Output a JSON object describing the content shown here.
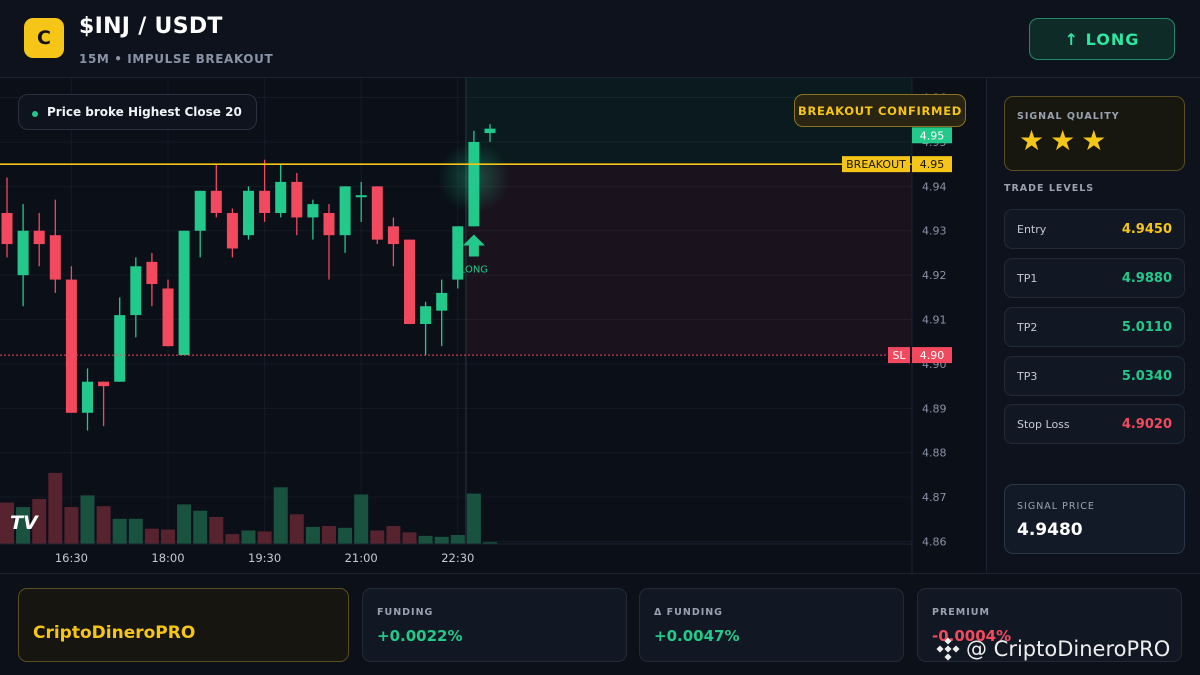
{
  "header": {
    "logo_letter": "C",
    "pair": "$INJ / USDT",
    "subtitle": "15M • IMPULSE BREAKOUT",
    "direction_label": "↑ LONG"
  },
  "chart": {
    "pill_text": "Price broke Highest Close 20",
    "confirm_label": "BREAKOUT CONFIRMED",
    "signal_marker_label": "LONG",
    "tv_logo": "TV",
    "colors": {
      "up": "#22c98a",
      "down": "#f2495e",
      "breakout": "#f5c518",
      "stop": "#f2495e"
    }
  },
  "chart_data": {
    "type": "candlestick",
    "y_ticks": [
      "4.96",
      "4.95",
      "4.94",
      "4.93",
      "4.92",
      "4.91",
      "4.90",
      "4.89",
      "4.88",
      "4.87",
      "4.86"
    ],
    "ylim": [
      4.857,
      4.9617
    ],
    "x_ticks": [
      {
        "label": "16:30",
        "index": 4
      },
      {
        "label": "18:00",
        "index": 10
      },
      {
        "label": "19:30",
        "index": 16
      },
      {
        "label": "21:00",
        "index": 22
      },
      {
        "label": "22:30",
        "index": 28
      }
    ],
    "candles": [
      {
        "o": 4.934,
        "h": 4.942,
        "l": 4.924,
        "c": 4.927
      },
      {
        "o": 4.92,
        "h": 4.936,
        "l": 4.913,
        "c": 4.93
      },
      {
        "o": 4.93,
        "h": 4.934,
        "l": 4.922,
        "c": 4.927
      },
      {
        "o": 4.929,
        "h": 4.937,
        "l": 4.916,
        "c": 4.919
      },
      {
        "o": 4.919,
        "h": 4.922,
        "l": 4.889,
        "c": 4.889
      },
      {
        "o": 4.889,
        "h": 4.899,
        "l": 4.885,
        "c": 4.896
      },
      {
        "o": 4.896,
        "h": 4.896,
        "l": 4.886,
        "c": 4.895
      },
      {
        "o": 4.896,
        "h": 4.915,
        "l": 4.896,
        "c": 4.911
      },
      {
        "o": 4.911,
        "h": 4.924,
        "l": 4.906,
        "c": 4.922
      },
      {
        "o": 4.923,
        "h": 4.925,
        "l": 4.913,
        "c": 4.918
      },
      {
        "o": 4.917,
        "h": 4.919,
        "l": 4.904,
        "c": 4.904
      },
      {
        "o": 4.902,
        "h": 4.93,
        "l": 4.902,
        "c": 4.93
      },
      {
        "o": 4.93,
        "h": 4.939,
        "l": 4.924,
        "c": 4.939
      },
      {
        "o": 4.939,
        "h": 4.945,
        "l": 4.933,
        "c": 4.934
      },
      {
        "o": 4.934,
        "h": 4.935,
        "l": 4.924,
        "c": 4.926
      },
      {
        "o": 4.929,
        "h": 4.94,
        "l": 4.928,
        "c": 4.939
      },
      {
        "o": 4.939,
        "h": 4.946,
        "l": 4.932,
        "c": 4.934
      },
      {
        "o": 4.934,
        "h": 4.945,
        "l": 4.933,
        "c": 4.941
      },
      {
        "o": 4.941,
        "h": 4.943,
        "l": 4.929,
        "c": 4.933
      },
      {
        "o": 4.933,
        "h": 4.937,
        "l": 4.928,
        "c": 4.936
      },
      {
        "o": 4.934,
        "h": 4.936,
        "l": 4.919,
        "c": 4.929
      },
      {
        "o": 4.929,
        "h": 4.94,
        "l": 4.925,
        "c": 4.94
      },
      {
        "o": 4.938,
        "h": 4.941,
        "l": 4.932,
        "c": 4.938
      },
      {
        "o": 4.94,
        "h": 4.94,
        "l": 4.927,
        "c": 4.928
      },
      {
        "o": 4.931,
        "h": 4.933,
        "l": 4.922,
        "c": 4.927
      },
      {
        "o": 4.928,
        "h": 4.928,
        "l": 4.909,
        "c": 4.909
      },
      {
        "o": 4.909,
        "h": 4.914,
        "l": 4.902,
        "c": 4.913
      },
      {
        "o": 4.912,
        "h": 4.919,
        "l": 4.904,
        "c": 4.916
      },
      {
        "o": 4.919,
        "h": 4.931,
        "l": 4.917,
        "c": 4.931
      },
      {
        "o": 4.931,
        "h": 4.9525,
        "l": 4.931,
        "c": 4.95
      },
      {
        "o": 4.952,
        "h": 4.954,
        "l": 4.95,
        "c": 4.953
      }
    ],
    "volumes": [
      0.46,
      0.41,
      0.5,
      0.79,
      0.41,
      0.54,
      0.42,
      0.28,
      0.28,
      0.17,
      0.16,
      0.44,
      0.37,
      0.3,
      0.11,
      0.15,
      0.14,
      0.63,
      0.33,
      0.19,
      0.2,
      0.18,
      0.55,
      0.15,
      0.2,
      0.13,
      0.09,
      0.08,
      0.1,
      0.56,
      0.02
    ],
    "breakout_level": 4.945,
    "stop_level": 4.902,
    "signal_index": 29
  },
  "price_tags": {
    "current": "4.95",
    "breakout_name": "BREAKOUT",
    "breakout_value": "4.95",
    "sl_name": "SL",
    "sl_value": "4.90"
  },
  "right_panel": {
    "quality_label": "SIGNAL QUALITY",
    "stars": [
      "★",
      "★",
      "★"
    ],
    "levels_title": "TRADE LEVELS",
    "levels": [
      {
        "name": "Entry",
        "value": "4.9450",
        "color": "#f5c518"
      },
      {
        "name": "TP1",
        "value": "4.9880",
        "color": "#22c98a"
      },
      {
        "name": "TP2",
        "value": "5.0110",
        "color": "#22c98a"
      },
      {
        "name": "TP3",
        "value": "5.0340",
        "color": "#22c98a"
      },
      {
        "name": "Stop Loss",
        "value": "4.9020",
        "color": "#f2495e"
      }
    ],
    "signal_price_label": "SIGNAL PRICE",
    "signal_price": "4.9480"
  },
  "footer": {
    "brand": "CriptoDineroPRO",
    "cards": [
      {
        "label": "FUNDING",
        "value": "+0.0022%",
        "color": "#22c98a"
      },
      {
        "label": "Δ FUNDING",
        "value": "+0.0047%",
        "color": "#22c98a"
      },
      {
        "label": "PREMIUM",
        "value": "-0.0004%",
        "color": "#f2495e"
      }
    ]
  },
  "watermark": "@ CriptoDineroPRO"
}
